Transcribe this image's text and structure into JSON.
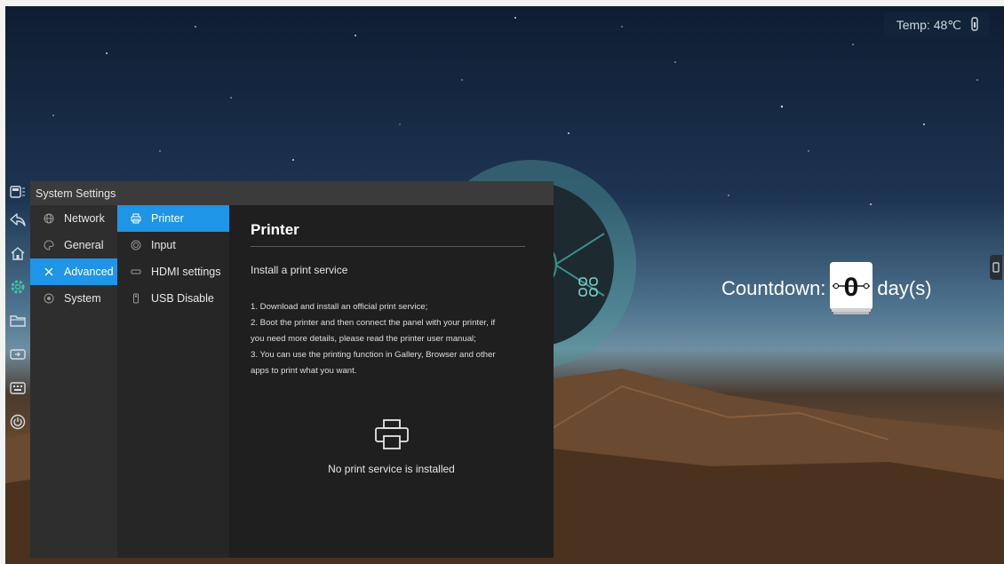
{
  "status": {
    "temp_label": "Temp:",
    "temp_value": "48℃"
  },
  "countdown": {
    "label": "Countdown:",
    "digit": "0",
    "unit": "day(s)"
  },
  "window": {
    "title": "System Settings",
    "categories": [
      {
        "label": "Network",
        "icon": "globe-icon"
      },
      {
        "label": "General",
        "icon": "palette-icon"
      },
      {
        "label": "Advanced",
        "icon": "tools-icon",
        "active": true
      },
      {
        "label": "System",
        "icon": "system-icon"
      }
    ],
    "subitems": [
      {
        "label": "Printer",
        "icon": "printer-icon",
        "active": true
      },
      {
        "label": "Input",
        "icon": "input-icon"
      },
      {
        "label": "HDMI settings",
        "icon": "hdmi-icon"
      },
      {
        "label": "USB Disable",
        "icon": "usb-icon"
      }
    ],
    "pane": {
      "title": "Printer",
      "subtitle": "Install a print service",
      "steps": [
        "1. Download and install an official print service;",
        "2. Boot the printer and then connect the panel with your printer, if",
        "you need more details, please read the printer user manual;",
        "3. You can use the printing function in Gallery, Browser and other",
        "apps to print what you want."
      ],
      "empty_text": "No print service is installed"
    }
  },
  "dock": [
    "apps-icon",
    "back-icon",
    "home-icon",
    "settings-icon",
    "folder-icon",
    "input-source-icon",
    "keyboard-icon",
    "power-icon"
  ],
  "colors": {
    "accent": "#1e95e6",
    "window_bg": "#2a2a2a"
  }
}
